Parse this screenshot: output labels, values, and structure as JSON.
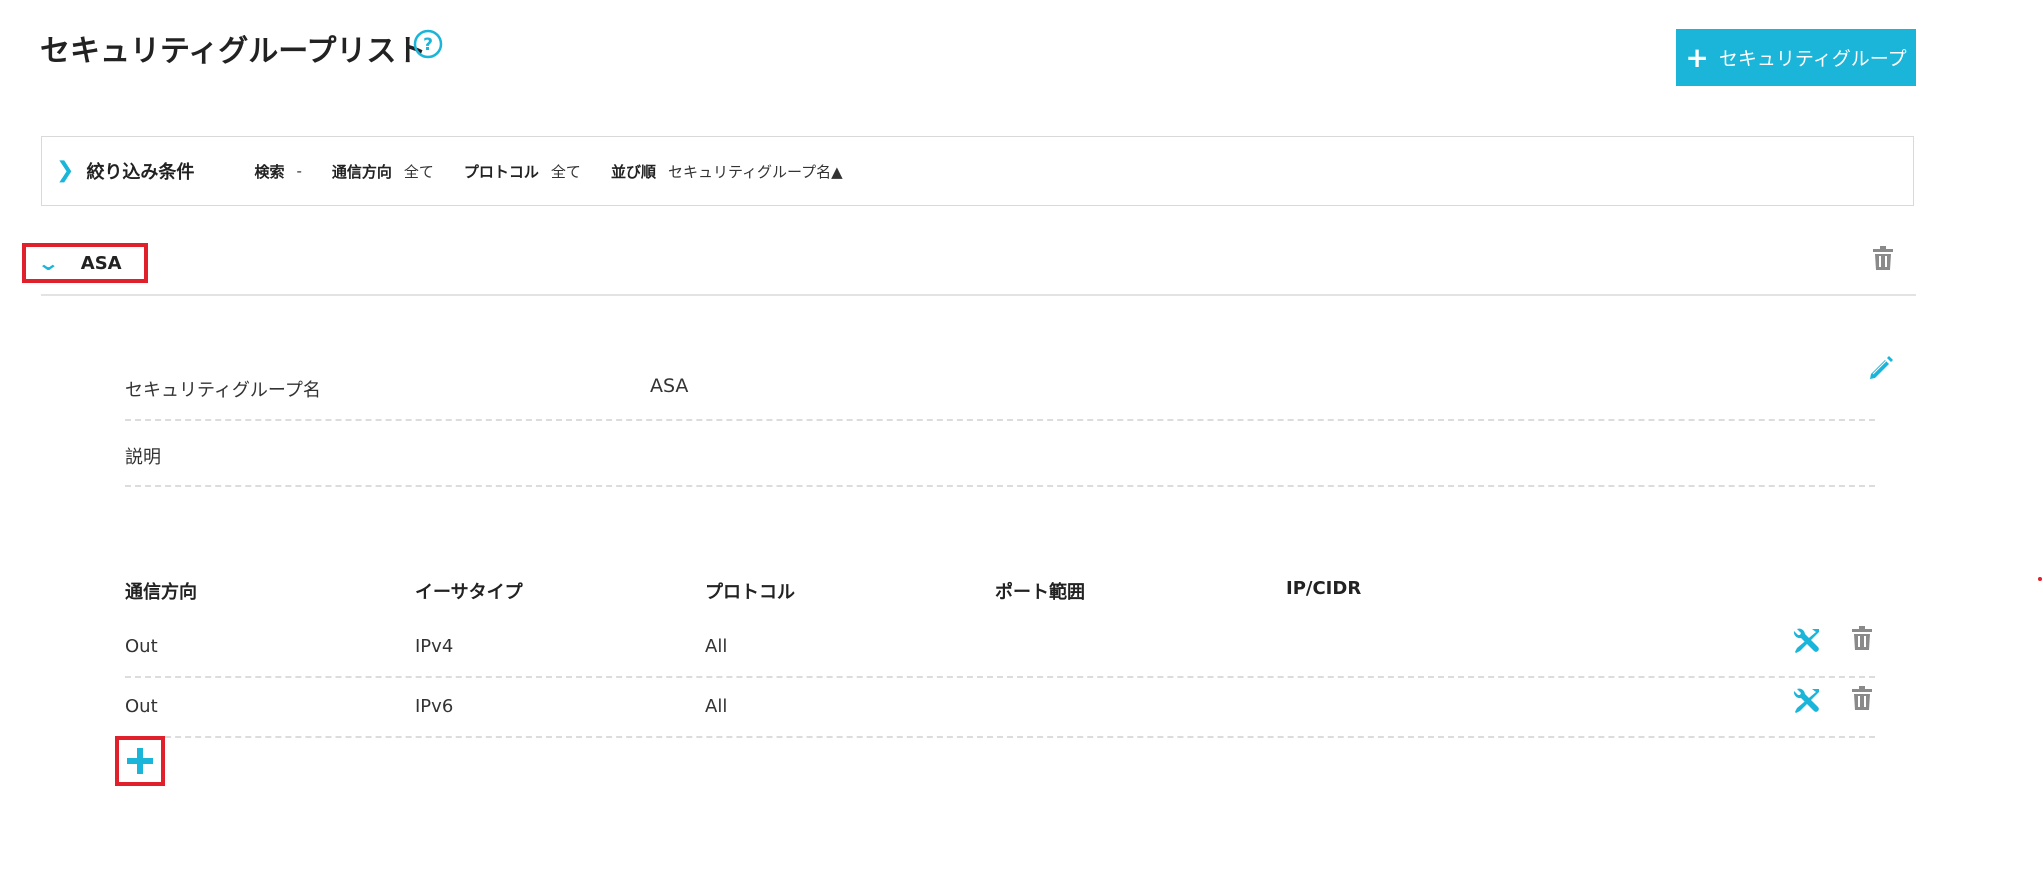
{
  "header": {
    "title": "セキュリティグループリスト",
    "add_button_label": "セキュリティグループ"
  },
  "filter": {
    "title": "絞り込み条件",
    "items": [
      {
        "label": "検索",
        "value": "-"
      },
      {
        "label": "通信方向",
        "value": "全て"
      },
      {
        "label": "プロトコル",
        "value": "全て"
      },
      {
        "label": "並び順",
        "value": "セキュリティグループ名▲"
      }
    ]
  },
  "group": {
    "name": "ASA",
    "details": {
      "name_label": "セキュリティグループ名",
      "name_value": "ASA",
      "description_label": "説明",
      "description_value": ""
    },
    "rules": {
      "columns": [
        "通信方向",
        "イーサタイプ",
        "プロトコル",
        "ポート範囲",
        "IP/CIDR"
      ],
      "rows": [
        {
          "direction": "Out",
          "ethertype": "IPv4",
          "protocol": "All",
          "port_range": "",
          "ip_cidr": ""
        },
        {
          "direction": "Out",
          "ethertype": "IPv6",
          "protocol": "All",
          "port_range": "",
          "ip_cidr": ""
        }
      ]
    }
  },
  "colors": {
    "accent": "#1ab5d9",
    "highlight": "#e0202a",
    "icon_gray": "#8a8a8a"
  },
  "icons": [
    "help-icon",
    "plus-icon",
    "chevron-right-icon",
    "chevron-down-icon",
    "trash-icon",
    "edit-icon",
    "tools-icon"
  ]
}
